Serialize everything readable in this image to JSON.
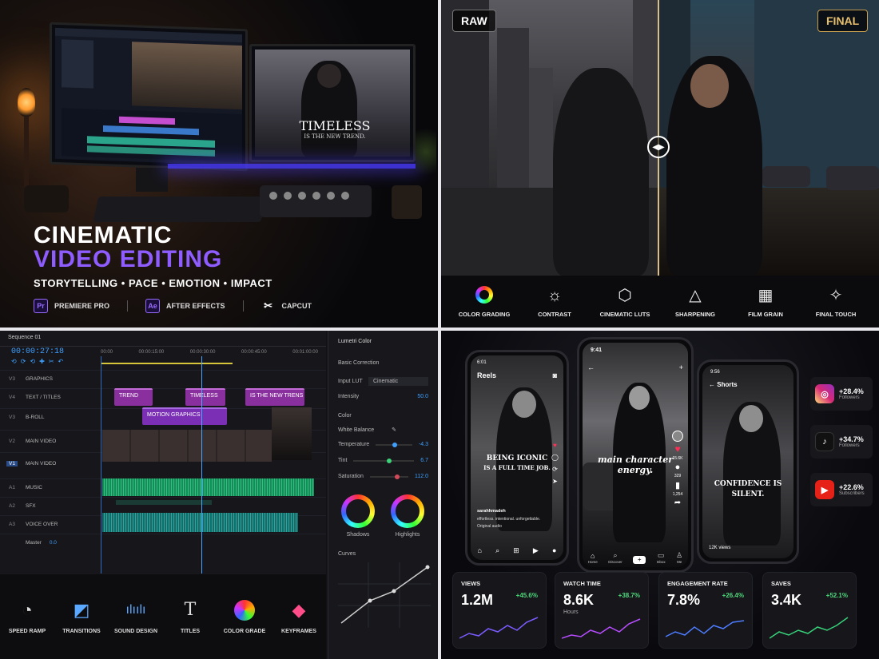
{
  "q1": {
    "title_line1": "CINEMATIC",
    "title_line2": "VIDEO EDITING",
    "subtitle": "STORYTELLING • PACE • EMOTION • IMPACT",
    "monitor_text_main": "TIMELESS",
    "monitor_text_sub": "IS THE NEW TREND.",
    "apps": [
      {
        "icon": "Pr",
        "label": "PREMIERE PRO",
        "color": "#9a6bff"
      },
      {
        "icon": "Ae",
        "label": "AFTER EFFECTS",
        "color": "#9a6bff"
      },
      {
        "icon": "capcut-icon",
        "label": "CAPCUT",
        "color": "#ffffff"
      }
    ]
  },
  "q2": {
    "badge_raw": "RAW",
    "badge_final": "FINAL",
    "tools": [
      {
        "icon": "color-wheel-icon",
        "label": "COLOR GRADING"
      },
      {
        "icon": "sun-icon",
        "label": "CONTRAST"
      },
      {
        "icon": "cube-icon",
        "label": "CINEMATIC LUTS"
      },
      {
        "icon": "triangle-icon",
        "label": "SHARPENING"
      },
      {
        "icon": "grain-icon",
        "label": "FILM GRAIN"
      },
      {
        "icon": "sparkle-icon",
        "label": "FINAL TOUCH"
      }
    ]
  },
  "q3": {
    "sequence_tab": "Sequence 01",
    "timecode": "00:00:27:18",
    "ruler": [
      "00:00",
      "00:00:15:00",
      "00:00:30:00",
      "00:00:45:00",
      "00:01:00:00"
    ],
    "tracks": [
      {
        "id": "V3",
        "name": "GRAPHICS"
      },
      {
        "id": "V4",
        "name": "TEXT / TITLES"
      },
      {
        "id": "V3",
        "name": "B-ROLL"
      },
      {
        "id": "V2",
        "name": "MAIN VIDEO"
      },
      {
        "id": "V1",
        "name": "MAIN VIDEO"
      },
      {
        "id": "A1",
        "name": "MUSIC"
      },
      {
        "id": "A2",
        "name": "SFX"
      },
      {
        "id": "A3",
        "name": "VOICE OVER"
      },
      {
        "id": "",
        "name": "Master"
      }
    ],
    "master_value": "0.0",
    "clips": [
      "TREND",
      "TIMELESS",
      "IS THE NEW TRENS",
      "MOTION GRAPHICS"
    ],
    "lumetri": {
      "title": "Lumetri Color",
      "section_basic": "Basic Correction",
      "input_lut_label": "Input LUT",
      "input_lut_value": "Cinematic",
      "intensity_label": "Intensity",
      "intensity_value": "50.0",
      "section_color": "Color",
      "white_balance": "White Balance",
      "temperature_label": "Temperature",
      "temperature_value": "-4.3",
      "tint_label": "Tint",
      "tint_value": "6.7",
      "saturation_label": "Saturation",
      "saturation_value": "112.0",
      "shadows": "Shadows",
      "highlights": "Highlights",
      "curves": "Curves"
    },
    "tools": [
      {
        "icon": "speedometer-icon",
        "label": "SPEED RAMP"
      },
      {
        "icon": "transition-icon",
        "label": "TRANSITIONS"
      },
      {
        "icon": "waveform-icon",
        "label": "SOUND DESIGN"
      },
      {
        "icon": "text-icon",
        "label": "TITLES"
      },
      {
        "icon": "color-circles-icon",
        "label": "COLOR GRADE"
      },
      {
        "icon": "keyframe-icon",
        "label": "KEYFRAMES"
      }
    ]
  },
  "q4": {
    "phone1": {
      "time": "6:01",
      "header": "Reels",
      "quote_line1": "BEING ICONIC",
      "quote_line2": "IS A FULL TIME JOB.",
      "user": "sarahhmadeh",
      "caption": "effortless. intentional. unforgettable.",
      "audio": "Original audio",
      "likes": "15.6K",
      "comments": "129"
    },
    "phone2": {
      "time": "9:41",
      "quote": "main character energy.",
      "likes": "15.6K",
      "comments": "329",
      "shares": "1,254",
      "nav": [
        "Home",
        "Discover",
        "",
        "Inbox",
        "Me"
      ]
    },
    "phone3": {
      "time": "9:56",
      "header": "Shorts",
      "quote_line1": "CONFIDENCE IS",
      "quote_line2": "SILENT.",
      "views": "12K views"
    },
    "social": [
      {
        "icon": "instagram-icon",
        "value": "+28.4%",
        "label": "Followers",
        "color": "#d6249f"
      },
      {
        "icon": "tiktok-icon",
        "value": "+34.7%",
        "label": "Followers",
        "color": "#111111"
      },
      {
        "icon": "youtube-icon",
        "value": "+22.6%",
        "label": "Subscribers",
        "color": "#e62117"
      }
    ],
    "stats": [
      {
        "label": "VIEWS",
        "value": "1.2M",
        "delta": "+45.6%",
        "sub": "",
        "color": "#7c5cff"
      },
      {
        "label": "WATCH TIME",
        "value": "8.6K",
        "delta": "+38.7%",
        "sub": "Hours",
        "color": "#b84dff"
      },
      {
        "label": "ENGAGEMENT RATE",
        "value": "7.8%",
        "delta": "+26.4%",
        "sub": "",
        "color": "#4d7cff"
      },
      {
        "label": "SAVES",
        "value": "3.4K",
        "delta": "+52.1%",
        "sub": "",
        "color": "#38d27a"
      }
    ]
  }
}
